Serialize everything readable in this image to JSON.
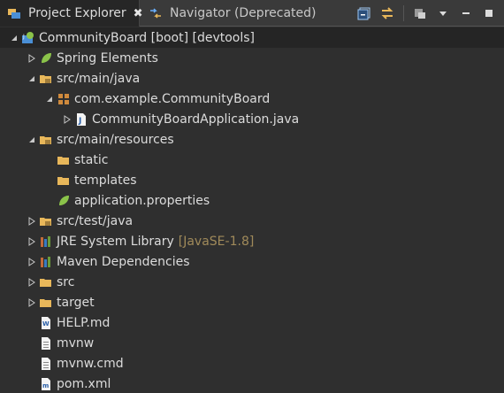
{
  "tabs": [
    {
      "label": "Project Explorer",
      "active": true,
      "close": "✖"
    },
    {
      "label": "Navigator (Deprecated)",
      "active": false
    }
  ],
  "toolbar": [
    "collapse-all-icon",
    "link-with-editor-icon",
    "filter-icon",
    "view-menu-icon",
    "minimize-icon",
    "maximize-icon"
  ],
  "tree": [
    {
      "label": "CommunityBoard [boot] [devtools]",
      "level": 0,
      "expanded": true,
      "icon": "spring-project-icon"
    },
    {
      "label": "Spring Elements",
      "level": 1,
      "expanded": false,
      "icon": "spring-leaf-icon"
    },
    {
      "label": "src/main/java",
      "level": 1,
      "expanded": true,
      "icon": "source-folder-icon"
    },
    {
      "label": "com.example.CommunityBoard",
      "level": 2,
      "expanded": true,
      "icon": "package-icon"
    },
    {
      "label": "CommunityBoardApplication.java",
      "level": 3,
      "expanded": false,
      "icon": "java-file-icon"
    },
    {
      "label": "src/main/resources",
      "level": 1,
      "expanded": true,
      "icon": "source-folder-icon"
    },
    {
      "label": "static",
      "level": 2,
      "icon": "folder-icon"
    },
    {
      "label": "templates",
      "level": 2,
      "icon": "folder-icon"
    },
    {
      "label": "application.properties",
      "level": 2,
      "icon": "spring-leaf-icon"
    },
    {
      "label": "src/test/java",
      "level": 1,
      "expanded": false,
      "icon": "source-folder-icon"
    },
    {
      "label": "JRE System Library",
      "decoration": "[JavaSE-1.8]",
      "level": 1,
      "expanded": false,
      "icon": "library-icon"
    },
    {
      "label": "Maven Dependencies",
      "level": 1,
      "expanded": false,
      "icon": "library-icon"
    },
    {
      "label": "src",
      "level": 1,
      "expanded": false,
      "icon": "folder-icon"
    },
    {
      "label": "target",
      "level": 1,
      "expanded": false,
      "icon": "folder-icon"
    },
    {
      "label": "HELP.md",
      "level": 1,
      "icon": "md-file-icon"
    },
    {
      "label": "mvnw",
      "level": 1,
      "icon": "file-icon"
    },
    {
      "label": "mvnw.cmd",
      "level": 1,
      "icon": "file-icon"
    },
    {
      "label": "pom.xml",
      "level": 1,
      "icon": "xml-file-icon"
    }
  ],
  "colors": {
    "background": "#2f2f2f",
    "text": "#dcdcdc",
    "decoration": "#a08a5a",
    "folder": "#e8b75a",
    "spring": "#8bc34a"
  }
}
